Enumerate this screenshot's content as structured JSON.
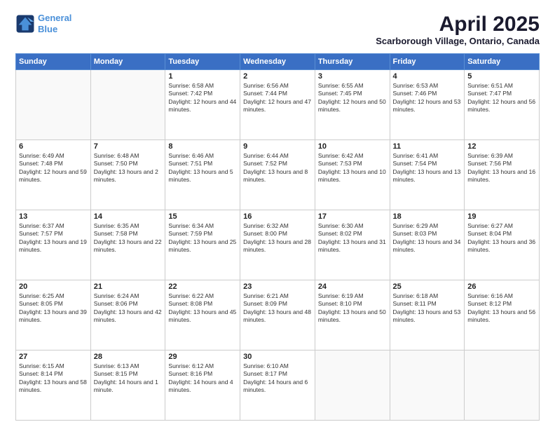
{
  "header": {
    "logo_line1": "General",
    "logo_line2": "Blue",
    "main_title": "April 2025",
    "subtitle": "Scarborough Village, Ontario, Canada"
  },
  "calendar": {
    "days_of_week": [
      "Sunday",
      "Monday",
      "Tuesday",
      "Wednesday",
      "Thursday",
      "Friday",
      "Saturday"
    ],
    "weeks": [
      [
        {
          "day": "",
          "sunrise": "",
          "sunset": "",
          "daylight": ""
        },
        {
          "day": "",
          "sunrise": "",
          "sunset": "",
          "daylight": ""
        },
        {
          "day": "1",
          "sunrise": "Sunrise: 6:58 AM",
          "sunset": "Sunset: 7:42 PM",
          "daylight": "Daylight: 12 hours and 44 minutes."
        },
        {
          "day": "2",
          "sunrise": "Sunrise: 6:56 AM",
          "sunset": "Sunset: 7:44 PM",
          "daylight": "Daylight: 12 hours and 47 minutes."
        },
        {
          "day": "3",
          "sunrise": "Sunrise: 6:55 AM",
          "sunset": "Sunset: 7:45 PM",
          "daylight": "Daylight: 12 hours and 50 minutes."
        },
        {
          "day": "4",
          "sunrise": "Sunrise: 6:53 AM",
          "sunset": "Sunset: 7:46 PM",
          "daylight": "Daylight: 12 hours and 53 minutes."
        },
        {
          "day": "5",
          "sunrise": "Sunrise: 6:51 AM",
          "sunset": "Sunset: 7:47 PM",
          "daylight": "Daylight: 12 hours and 56 minutes."
        }
      ],
      [
        {
          "day": "6",
          "sunrise": "Sunrise: 6:49 AM",
          "sunset": "Sunset: 7:48 PM",
          "daylight": "Daylight: 12 hours and 59 minutes."
        },
        {
          "day": "7",
          "sunrise": "Sunrise: 6:48 AM",
          "sunset": "Sunset: 7:50 PM",
          "daylight": "Daylight: 13 hours and 2 minutes."
        },
        {
          "day": "8",
          "sunrise": "Sunrise: 6:46 AM",
          "sunset": "Sunset: 7:51 PM",
          "daylight": "Daylight: 13 hours and 5 minutes."
        },
        {
          "day": "9",
          "sunrise": "Sunrise: 6:44 AM",
          "sunset": "Sunset: 7:52 PM",
          "daylight": "Daylight: 13 hours and 8 minutes."
        },
        {
          "day": "10",
          "sunrise": "Sunrise: 6:42 AM",
          "sunset": "Sunset: 7:53 PM",
          "daylight": "Daylight: 13 hours and 10 minutes."
        },
        {
          "day": "11",
          "sunrise": "Sunrise: 6:41 AM",
          "sunset": "Sunset: 7:54 PM",
          "daylight": "Daylight: 13 hours and 13 minutes."
        },
        {
          "day": "12",
          "sunrise": "Sunrise: 6:39 AM",
          "sunset": "Sunset: 7:56 PM",
          "daylight": "Daylight: 13 hours and 16 minutes."
        }
      ],
      [
        {
          "day": "13",
          "sunrise": "Sunrise: 6:37 AM",
          "sunset": "Sunset: 7:57 PM",
          "daylight": "Daylight: 13 hours and 19 minutes."
        },
        {
          "day": "14",
          "sunrise": "Sunrise: 6:35 AM",
          "sunset": "Sunset: 7:58 PM",
          "daylight": "Daylight: 13 hours and 22 minutes."
        },
        {
          "day": "15",
          "sunrise": "Sunrise: 6:34 AM",
          "sunset": "Sunset: 7:59 PM",
          "daylight": "Daylight: 13 hours and 25 minutes."
        },
        {
          "day": "16",
          "sunrise": "Sunrise: 6:32 AM",
          "sunset": "Sunset: 8:00 PM",
          "daylight": "Daylight: 13 hours and 28 minutes."
        },
        {
          "day": "17",
          "sunrise": "Sunrise: 6:30 AM",
          "sunset": "Sunset: 8:02 PM",
          "daylight": "Daylight: 13 hours and 31 minutes."
        },
        {
          "day": "18",
          "sunrise": "Sunrise: 6:29 AM",
          "sunset": "Sunset: 8:03 PM",
          "daylight": "Daylight: 13 hours and 34 minutes."
        },
        {
          "day": "19",
          "sunrise": "Sunrise: 6:27 AM",
          "sunset": "Sunset: 8:04 PM",
          "daylight": "Daylight: 13 hours and 36 minutes."
        }
      ],
      [
        {
          "day": "20",
          "sunrise": "Sunrise: 6:25 AM",
          "sunset": "Sunset: 8:05 PM",
          "daylight": "Daylight: 13 hours and 39 minutes."
        },
        {
          "day": "21",
          "sunrise": "Sunrise: 6:24 AM",
          "sunset": "Sunset: 8:06 PM",
          "daylight": "Daylight: 13 hours and 42 minutes."
        },
        {
          "day": "22",
          "sunrise": "Sunrise: 6:22 AM",
          "sunset": "Sunset: 8:08 PM",
          "daylight": "Daylight: 13 hours and 45 minutes."
        },
        {
          "day": "23",
          "sunrise": "Sunrise: 6:21 AM",
          "sunset": "Sunset: 8:09 PM",
          "daylight": "Daylight: 13 hours and 48 minutes."
        },
        {
          "day": "24",
          "sunrise": "Sunrise: 6:19 AM",
          "sunset": "Sunset: 8:10 PM",
          "daylight": "Daylight: 13 hours and 50 minutes."
        },
        {
          "day": "25",
          "sunrise": "Sunrise: 6:18 AM",
          "sunset": "Sunset: 8:11 PM",
          "daylight": "Daylight: 13 hours and 53 minutes."
        },
        {
          "day": "26",
          "sunrise": "Sunrise: 6:16 AM",
          "sunset": "Sunset: 8:12 PM",
          "daylight": "Daylight: 13 hours and 56 minutes."
        }
      ],
      [
        {
          "day": "27",
          "sunrise": "Sunrise: 6:15 AM",
          "sunset": "Sunset: 8:14 PM",
          "daylight": "Daylight: 13 hours and 58 minutes."
        },
        {
          "day": "28",
          "sunrise": "Sunrise: 6:13 AM",
          "sunset": "Sunset: 8:15 PM",
          "daylight": "Daylight: 14 hours and 1 minute."
        },
        {
          "day": "29",
          "sunrise": "Sunrise: 6:12 AM",
          "sunset": "Sunset: 8:16 PM",
          "daylight": "Daylight: 14 hours and 4 minutes."
        },
        {
          "day": "30",
          "sunrise": "Sunrise: 6:10 AM",
          "sunset": "Sunset: 8:17 PM",
          "daylight": "Daylight: 14 hours and 6 minutes."
        },
        {
          "day": "",
          "sunrise": "",
          "sunset": "",
          "daylight": ""
        },
        {
          "day": "",
          "sunrise": "",
          "sunset": "",
          "daylight": ""
        },
        {
          "day": "",
          "sunrise": "",
          "sunset": "",
          "daylight": ""
        }
      ]
    ]
  }
}
